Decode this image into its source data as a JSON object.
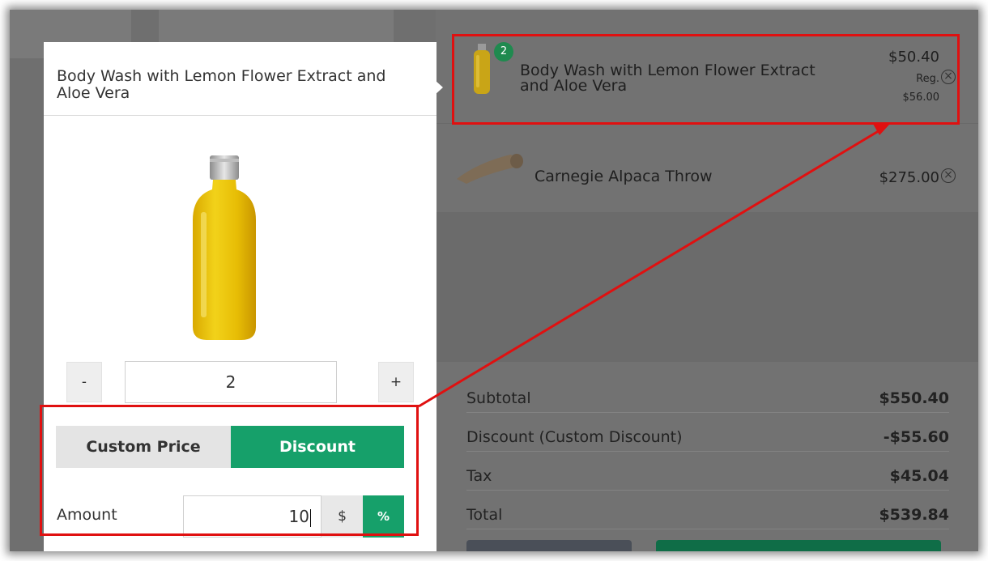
{
  "popover": {
    "title": "Body Wash with Lemon Flower Extract and Aloe Vera",
    "quantity": {
      "minus_label": "-",
      "value": "2",
      "plus_label": "+"
    },
    "mode_tabs": [
      {
        "label": "Custom Price",
        "active": false
      },
      {
        "label": "Discount",
        "active": true
      }
    ],
    "amount": {
      "label": "Amount",
      "value": "10",
      "unit_dollar": "$",
      "unit_percent": "%",
      "selected_unit": "%"
    }
  },
  "cart": {
    "items": [
      {
        "name": "Body Wash with Lemon Flower Extract and Aloe Vera",
        "quantity_badge": "2",
        "price": "$50.40",
        "reg_label": "Reg.",
        "reg_price": "$56.00",
        "icon": "bottle-thumbnail"
      },
      {
        "name": "Carnegie Alpaca Throw",
        "price": "$275.00",
        "icon": "throw-thumbnail"
      }
    ],
    "totals": [
      {
        "label": "Subtotal",
        "value": "$550.40"
      },
      {
        "label": "Discount (Custom Discount)",
        "value": "-$55.60"
      },
      {
        "label": "Tax",
        "value": "$45.04"
      },
      {
        "label": "Total",
        "value": "$539.84"
      }
    ]
  },
  "colors": {
    "accent_green": "#16a06a",
    "badge_green": "#1f8a4f",
    "annotation_red": "#e01010",
    "overlay_gray": "#757575"
  }
}
